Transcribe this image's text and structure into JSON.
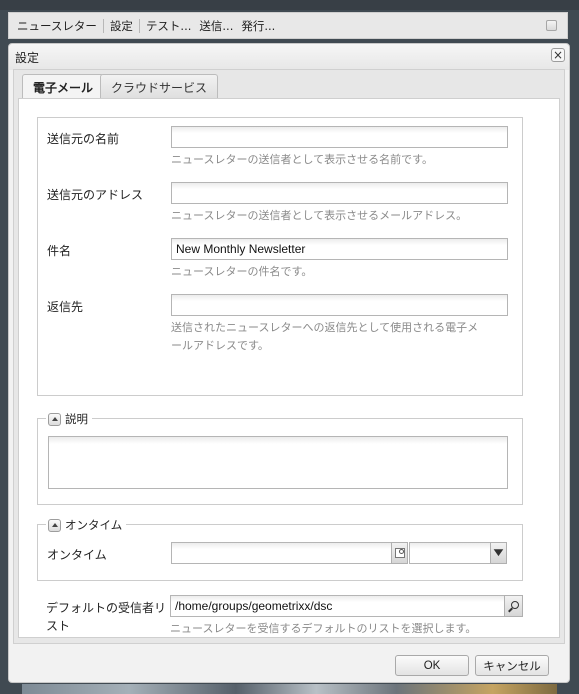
{
  "sidekick": {
    "items": [
      "ニュースレター",
      "設定",
      "テスト...",
      "送信...",
      "発行..."
    ]
  },
  "dialog": {
    "title": "設定",
    "close_label": "×",
    "tabs": [
      {
        "label": "電子メール",
        "active": true
      },
      {
        "label": "クラウドサービス",
        "active": false
      }
    ],
    "email": {
      "fields": [
        {
          "label": "送信元の名前",
          "value": "",
          "help": "ニュースレターの送信者として表示させる名前です。"
        },
        {
          "label": "送信元のアドレス",
          "value": "",
          "help": "ニュースレターの送信者として表示させるメールアドレス。"
        },
        {
          "label": "件名",
          "value": "New Monthly Newsletter",
          "help": "ニュースレターの件名です。"
        },
        {
          "label": "返信先",
          "value": "",
          "help_line1": "送信されたニュースレターへの返信先として使用される電子メ",
          "help_line2": "ールアドレスです。"
        }
      ],
      "description": {
        "legend": "説明",
        "value": ""
      },
      "ontime": {
        "legend": "オンタイム",
        "label": "オンタイム",
        "date_value": "",
        "time_value": ""
      },
      "recipient_list": {
        "label_line1": "デフォルトの受信者リ",
        "label_line2": "スト",
        "value": "/home/groups/geometrixx/dsc",
        "help": "ニュースレターを受信するデフォルトのリストを選択します。"
      }
    },
    "buttons": {
      "ok": "OK",
      "cancel": "キャンセル"
    }
  }
}
